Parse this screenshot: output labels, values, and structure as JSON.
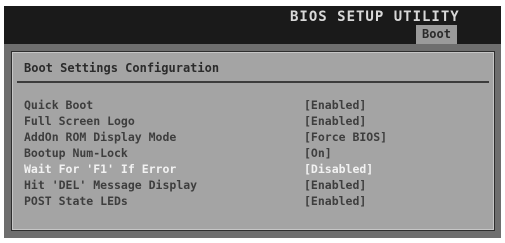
{
  "header": {
    "title": "BIOS SETUP UTILITY",
    "active_tab": "Boot"
  },
  "panel": {
    "title": "Boot Settings Configuration"
  },
  "settings": [
    {
      "label": "Quick Boot",
      "value": "[Enabled]"
    },
    {
      "label": "Full Screen Logo",
      "value": "[Enabled]"
    },
    {
      "label": "AddOn ROM Display Mode",
      "value": "[Force BIOS]"
    },
    {
      "label": "Bootup Num-Lock",
      "value": "[On]"
    },
    {
      "label": "Wait For 'F1' If Error",
      "value": "[Disabled]"
    },
    {
      "label": "Hit 'DEL' Message Display",
      "value": "[Enabled]"
    },
    {
      "label": "POST State LEDs",
      "value": "[Enabled]"
    }
  ],
  "selected_index": 4,
  "colors": {
    "background": "#6e6e6e",
    "header": "#1a1a1a",
    "panel": "#a4a4a4",
    "text": "#3e3e3e",
    "highlight": "#f2f2f2"
  }
}
